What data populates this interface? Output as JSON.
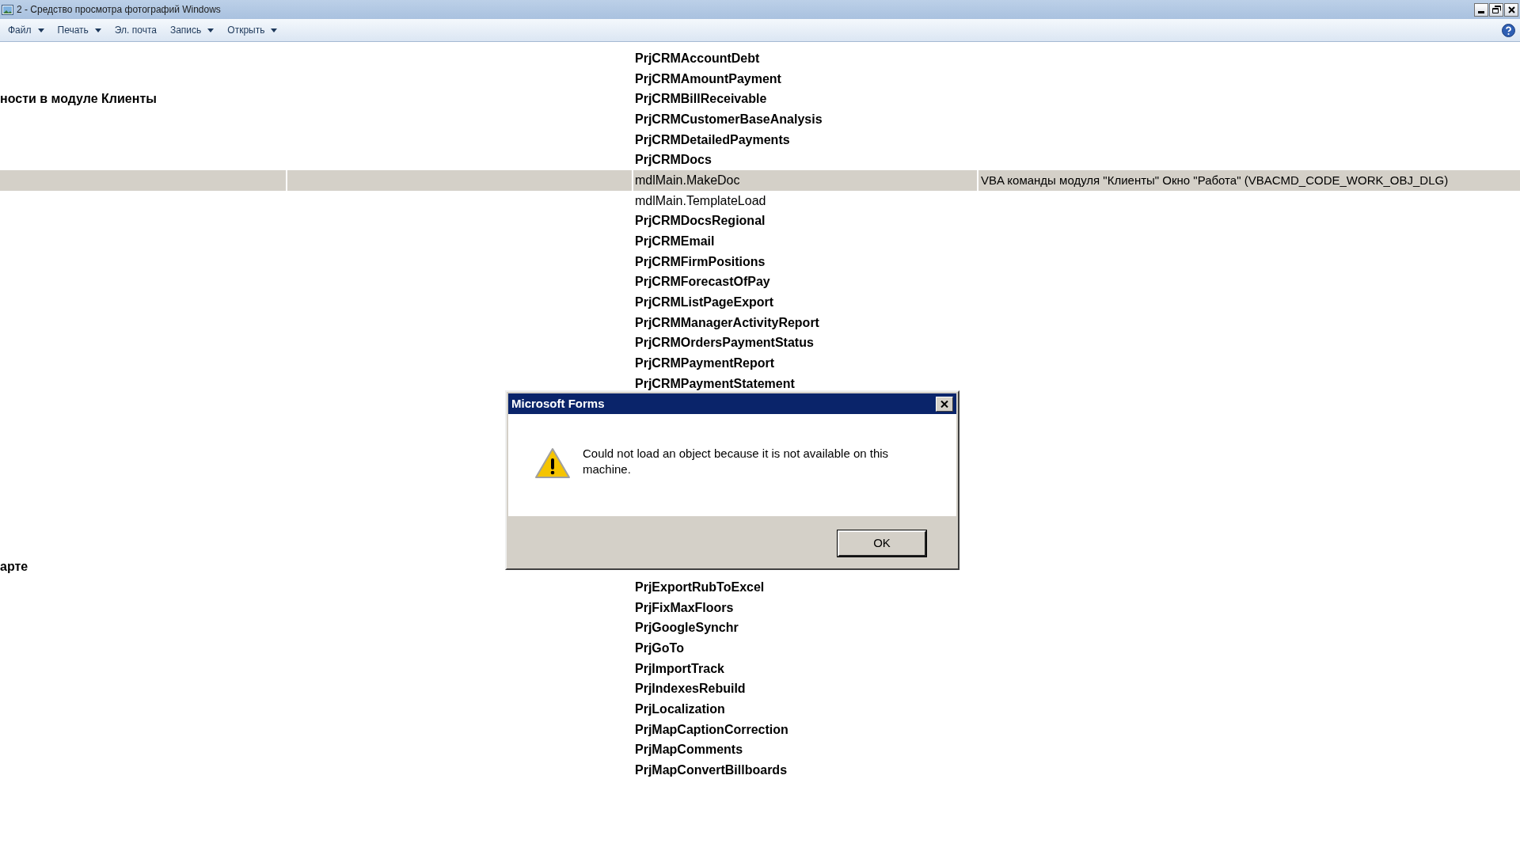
{
  "window": {
    "title": "2 - Средство просмотра фотографий Windows"
  },
  "menu": [
    {
      "label": "Файл",
      "dropdown": true
    },
    {
      "label": "Печать",
      "dropdown": true
    },
    {
      "label": "Эл. почта",
      "dropdown": false
    },
    {
      "label": "Запись",
      "dropdown": true
    },
    {
      "label": "Открыть",
      "dropdown": true
    }
  ],
  "table": {
    "rows_top": [
      {
        "column_3": "PrjCRMAccountDebt",
        "kind": "project",
        "selected": false
      },
      {
        "column_3": "PrjCRMAmountPayment",
        "kind": "project",
        "selected": false
      },
      {
        "column_1": "ности в модуле Клиенты",
        "column_3": "PrjCRMBillReceivable",
        "kind": "project",
        "selected": false
      },
      {
        "column_3": "PrjCRMCustomerBaseAnalysis",
        "kind": "project",
        "selected": false
      },
      {
        "column_3": "PrjCRMDetailedPayments",
        "kind": "project",
        "selected": false
      },
      {
        "column_3": "PrjCRMDocs",
        "kind": "project",
        "selected": false
      },
      {
        "column_3": "mdlMain.MakeDoc",
        "column_4": "VBA команды модуля \"Клиенты\" Окно \"Работа\" (VBACMD_CODE_WORK_OBJ_DLG)",
        "kind": "procedure",
        "selected": true
      },
      {
        "column_3": "mdlMain.TemplateLoad",
        "kind": "procedure",
        "selected": false
      },
      {
        "column_3": "PrjCRMDocsRegional",
        "kind": "project",
        "selected": false
      },
      {
        "column_3": "PrjCRMEmail",
        "kind": "project",
        "selected": false
      },
      {
        "column_3": "PrjCRMFirmPositions",
        "kind": "project",
        "selected": false
      },
      {
        "column_3": "PrjCRMForecastOfPay",
        "kind": "project",
        "selected": false
      },
      {
        "column_3": "PrjCRMListPageExport",
        "kind": "project",
        "selected": false
      },
      {
        "column_3": "PrjCRMManagerActivityReport",
        "kind": "project",
        "selected": false
      },
      {
        "column_3": "PrjCRMOrdersPaymentStatus",
        "kind": "project",
        "selected": false
      },
      {
        "column_3": "PrjCRMPaymentReport",
        "kind": "project",
        "selected": false
      },
      {
        "column_3": "PrjCRMPaymentStatement",
        "kind": "project",
        "selected": false
      }
    ],
    "rows_bottom": [
      {
        "column_1": "арте",
        "kind": "project",
        "selected": false
      },
      {
        "column_3": "PrjExportRubToExcel",
        "kind": "project",
        "selected": false
      },
      {
        "column_3": "PrjFixMaxFloors",
        "kind": "project",
        "selected": false
      },
      {
        "column_3": "PrjGoogleSynchr",
        "kind": "project",
        "selected": false
      },
      {
        "column_3": "PrjGoTo",
        "kind": "project",
        "selected": false
      },
      {
        "column_3": "PrjImportTrack",
        "kind": "project",
        "selected": false
      },
      {
        "column_3": "PrjIndexesRebuild",
        "kind": "project",
        "selected": false
      },
      {
        "column_3": "PrjLocalization",
        "kind": "project",
        "selected": false
      },
      {
        "column_3": "PrjMapCaptionCorrection",
        "kind": "project",
        "selected": false
      },
      {
        "column_3": "PrjMapComments",
        "kind": "project",
        "selected": false
      },
      {
        "column_3": "PrjMapConvertBillboards",
        "kind": "project",
        "selected": false
      }
    ]
  },
  "dialog": {
    "title": "Microsoft Forms",
    "message": "Could not load an object because it is not available on this machine.",
    "button": "OK"
  }
}
